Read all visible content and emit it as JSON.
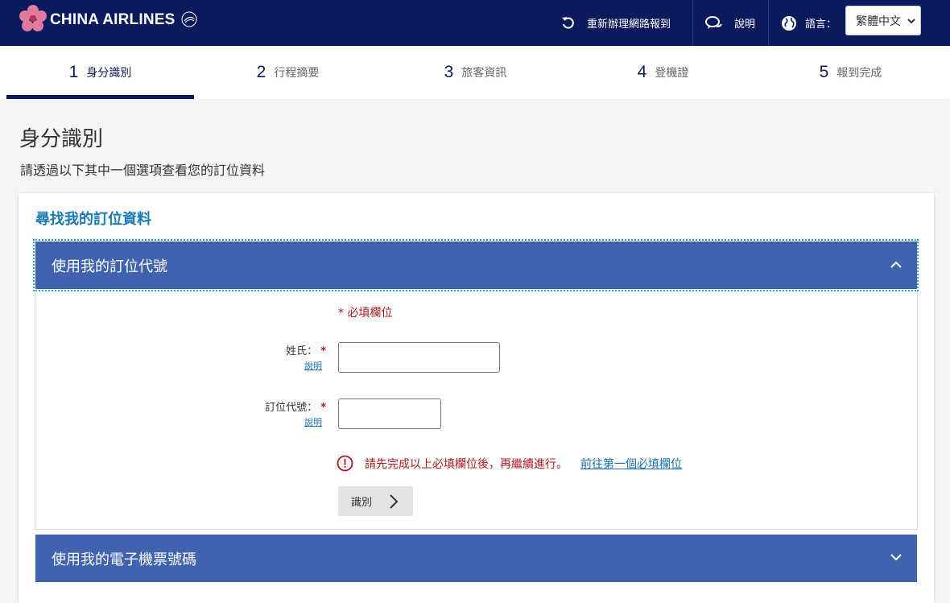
{
  "header": {
    "brand": "CHINA AIRLINES",
    "restart_label": "重新辦理網路報到",
    "help_label": "說明",
    "language_label": "語言：",
    "language_value": "繁體中文",
    "colors": {
      "navy": "#0a1a5c",
      "accent_blue": "#4063b0",
      "link": "#1a6fb5",
      "error": "#b0161c"
    }
  },
  "steps": [
    {
      "num": "1",
      "label": "身分識別",
      "active": true
    },
    {
      "num": "2",
      "label": "行程摘要"
    },
    {
      "num": "3",
      "label": "旅客資訊"
    },
    {
      "num": "4",
      "label": "登機證"
    },
    {
      "num": "5",
      "label": "報到完成"
    }
  ],
  "page": {
    "title": "身分識別",
    "subtitle": "請透過以下其中一個選項查看您的訂位資料"
  },
  "card": {
    "title": "尋找我的訂位資料",
    "accordion_booking": {
      "title": "使用我的訂位代號",
      "expanded": true,
      "required_note": "* 必填欄位",
      "fields": [
        {
          "label": "姓氏：",
          "star": "*",
          "help": "說明",
          "value": ""
        },
        {
          "label": "訂位代號：",
          "star": "*",
          "help": "說明",
          "value": ""
        }
      ],
      "error_text": "請先完成以上必填欄位後，再繼續進行。",
      "error_link": "前往第一個必填欄位",
      "submit_label": "識別"
    },
    "accordion_ticket": {
      "title": "使用我的電子機票號碼",
      "expanded": false
    }
  },
  "icons": {
    "restart": "restart-icon",
    "help": "chat-bubbles-icon",
    "language": "globe-icon",
    "error": "alert-circle-icon"
  }
}
